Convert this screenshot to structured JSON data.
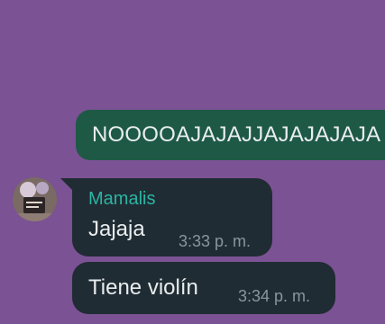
{
  "colors": {
    "background": "#7b5294",
    "outgoing_bubble": "#1e5945",
    "incoming_bubble": "#202c33",
    "sender_name": "#2bb5a4",
    "message_text": "#e9edef",
    "timestamp_text": "#8696a0"
  },
  "messages": {
    "outgoing": [
      {
        "text": "NOOOOAJAJAJJAJAJAJAJA"
      }
    ],
    "incoming_group": {
      "sender": "Mamalis",
      "avatar_icon": "contact-photo-icon",
      "items": [
        {
          "text": "Jajaja",
          "time": "3:33 p. m."
        },
        {
          "text": "Tiene violín",
          "time": "3:34 p. m."
        }
      ]
    }
  }
}
